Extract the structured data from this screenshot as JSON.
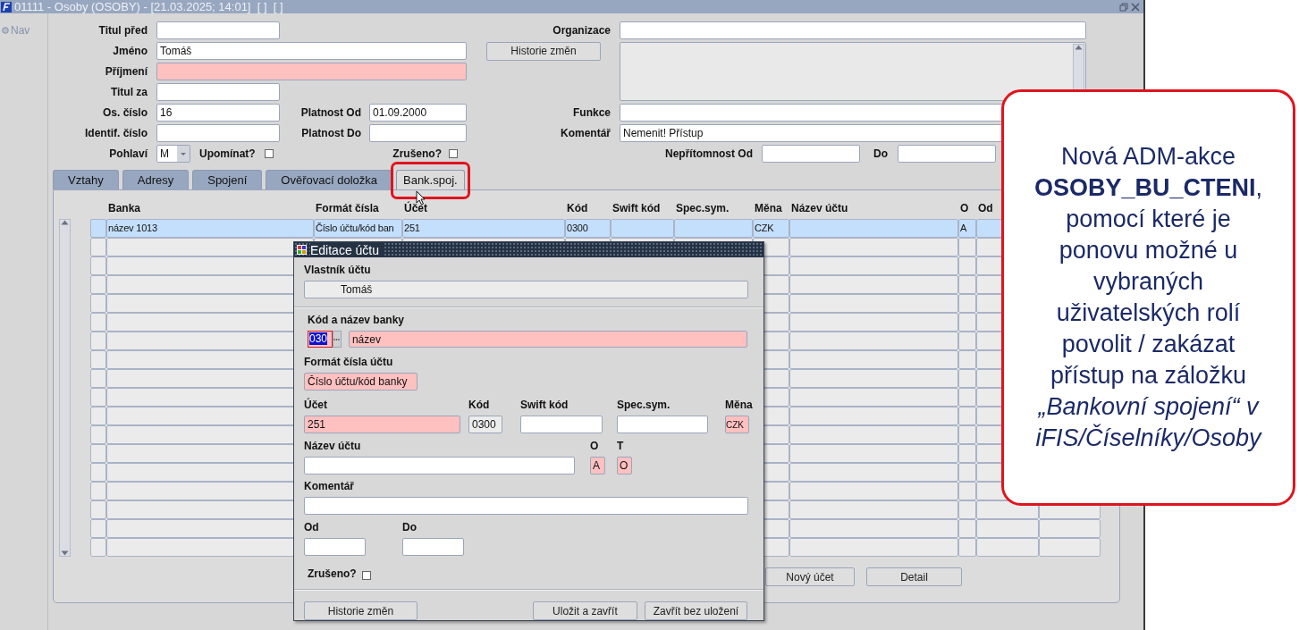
{
  "window": {
    "title": "01111 - Osoby (OSOBY) - [21.03.2025; 14:01]  [ ]  [ ]"
  },
  "nav": {
    "label": "Nav"
  },
  "form": {
    "titul_pred": {
      "label": "Titul před"
    },
    "jmeno": {
      "label": "Jméno",
      "value": "Tomáš"
    },
    "prijmeni": {
      "label": "Příjmení",
      "required": true
    },
    "titul_za": {
      "label": "Titul za"
    },
    "os_cislo": {
      "label": "Os. číslo",
      "value": "16"
    },
    "platnost_od": {
      "label": "Platnost Od",
      "value": "01.09.2000"
    },
    "identif_cislo": {
      "label": "Identif. číslo"
    },
    "platnost_do": {
      "label": "Platnost Do"
    },
    "pohlavi": {
      "label": "Pohlaví",
      "value": "M"
    },
    "upominat": {
      "label": "Upomínat?",
      "checked": false
    },
    "zruseno": {
      "label": "Zrušeno?",
      "checked": false
    },
    "organizace": {
      "label": "Organizace"
    },
    "history_button": "Historie změn",
    "funkce": {
      "label": "Funkce"
    },
    "komentar": {
      "label": "Komentář",
      "value": "Nemenit! Přístup"
    },
    "nepritomnost_od": {
      "label": "Nepřítomnost Od"
    },
    "nepritomnost_do": {
      "label": "Do"
    }
  },
  "tabs": [
    {
      "label": "Vztahy",
      "selected": false
    },
    {
      "label": "Adresy",
      "selected": false
    },
    {
      "label": "Spojení",
      "selected": false
    },
    {
      "label": "Ověřovací doložka",
      "selected": false
    },
    {
      "label": "Bank.spoj.",
      "selected": true
    }
  ],
  "table": {
    "columns": [
      "Banka",
      "Formát čísla",
      "Účet",
      "Kód",
      "Swift kód",
      "Spec.sym.",
      "Měna",
      "Název účtu",
      "O",
      "Od"
    ],
    "rows": [
      {
        "selected": true,
        "cells": [
          "název 1013",
          "Číslo účtu/kód ban",
          "251",
          "0300",
          null,
          null,
          "CZK",
          null,
          "A",
          null
        ]
      }
    ]
  },
  "table_buttons": [
    "Nový účet",
    "Detail"
  ],
  "dialog": {
    "title": "Editace účtu",
    "owner": {
      "label": "Vlastník účtu",
      "value": "Tomáš",
      "readonly": true
    },
    "bank": {
      "label": "Kód a název banky",
      "code": "030",
      "name": "název",
      "required": true
    },
    "format": {
      "label": "Formát čísla účtu",
      "value": "Číslo účtu/kód banky",
      "required": true
    },
    "ucet": {
      "label": "Účet",
      "value": "251",
      "required": true
    },
    "kod": {
      "label": "Kód",
      "value": "0300",
      "readonly": true
    },
    "swift": {
      "label": "Swift kód"
    },
    "spec": {
      "label": "Spec.sym."
    },
    "mena": {
      "label": "Měna",
      "value": "CZK",
      "required": true
    },
    "nazev": {
      "label": "Název účtu"
    },
    "o": {
      "label": "O",
      "value": "A",
      "required": true
    },
    "t": {
      "label": "T",
      "value": "O",
      "required": true
    },
    "komentar": {
      "label": "Komentář"
    },
    "od": {
      "label": "Od"
    },
    "do": {
      "label": "Do"
    },
    "zruseno": {
      "label": "Zrušeno?",
      "checked": false
    },
    "buttons": [
      "Historie změn",
      "Uložit a zavřít",
      "Zavřít bez uložení"
    ]
  },
  "callout": {
    "text": "Nová ADM-akce **OSOBY_BU_CTENI**, pomocí které je ponovu možné u vybraných uživatelských rolí povolit / zakázat přístup na záložku *„Bankovní spojení“ v iFIS/Číselníky/Osoby*"
  }
}
